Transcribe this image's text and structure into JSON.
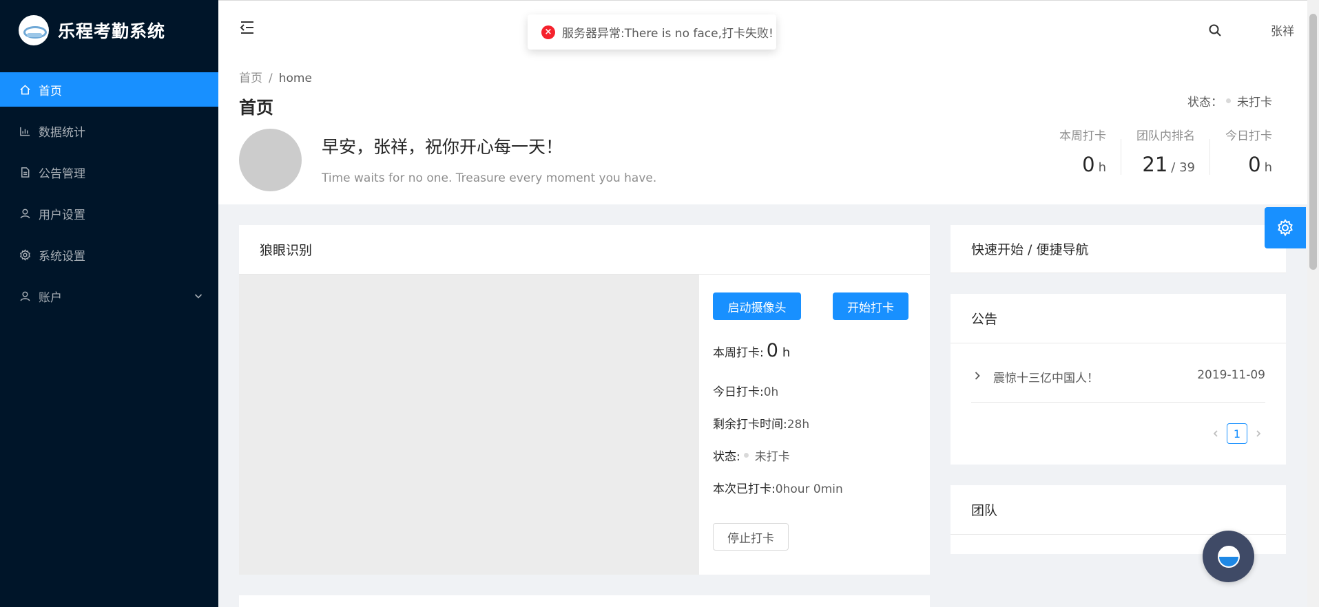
{
  "app": {
    "title": "乐程考勤系统"
  },
  "sidebar": {
    "items": [
      {
        "label": "首页",
        "icon": "home-icon",
        "active": true
      },
      {
        "label": "数据统计",
        "icon": "bar-chart-icon"
      },
      {
        "label": "公告管理",
        "icon": "file-icon"
      },
      {
        "label": "用户设置",
        "icon": "user-icon"
      },
      {
        "label": "系统设置",
        "icon": "setting-icon"
      },
      {
        "label": "账户",
        "icon": "user-icon",
        "expandable": true
      }
    ]
  },
  "header": {
    "user_name": "张祥"
  },
  "toast": {
    "message": "服务器异常:There is no face,打卡失败!",
    "type": "error",
    "color": "#f5222d"
  },
  "page_header": {
    "breadcrumb": {
      "home": "首页",
      "separator": "/",
      "current": "home"
    },
    "title": "首页",
    "status_label": "状态：",
    "status_value": "未打卡",
    "greeting": "早安，张祥，祝你开心每一天！",
    "motto": "Time waits for no one. Treasure every moment you have.",
    "stats": [
      {
        "label": "本周打卡",
        "value": "0",
        "unit": "h"
      },
      {
        "label": "团队内排名",
        "value": "21",
        "unit": "/ 39"
      },
      {
        "label": "今日打卡",
        "value": "0",
        "unit": "h"
      }
    ]
  },
  "face_card": {
    "title": "狼眼识别",
    "start_camera": "启动摄像头",
    "start_clock": "开始打卡",
    "week_label": "本周打卡:",
    "week_value": "0",
    "week_unit": "h",
    "today_label": "今日打卡:",
    "today_value": "0h",
    "remain_label": "剩余打卡时间:",
    "remain_value": "28h",
    "status_label": "状态:",
    "status_value": "未打卡",
    "session_label": "本次已打卡:",
    "session_value": "0hour 0min",
    "stop_clock": "停止打卡"
  },
  "quick_card": {
    "title": "快速开始 / 便捷导航"
  },
  "notice_card": {
    "title": "公告",
    "items": [
      {
        "title": "震惊十三亿中国人！",
        "date": "2019-11-09"
      }
    ],
    "current_page": "1"
  },
  "team_card": {
    "title": "团队"
  },
  "colors": {
    "primary": "#1890ff",
    "sidebar_bg": "#001529",
    "error": "#f5222d"
  }
}
